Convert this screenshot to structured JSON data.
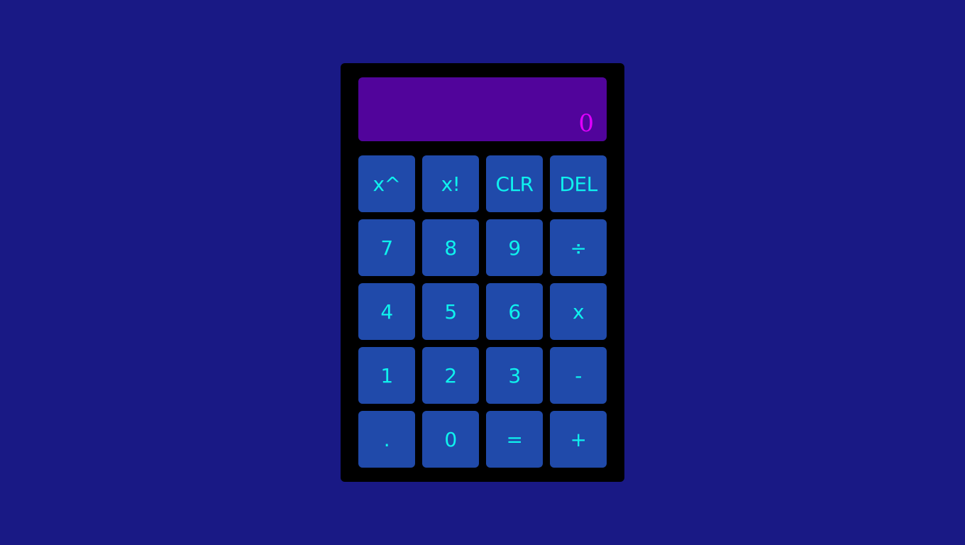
{
  "display": {
    "value": "0"
  },
  "keys": [
    {
      "id": "power",
      "label": "x^"
    },
    {
      "id": "factorial",
      "label": "x!"
    },
    {
      "id": "clear",
      "label": "CLR"
    },
    {
      "id": "delete",
      "label": "DEL"
    },
    {
      "id": "7",
      "label": "7"
    },
    {
      "id": "8",
      "label": "8"
    },
    {
      "id": "9",
      "label": "9"
    },
    {
      "id": "divide",
      "label": "÷"
    },
    {
      "id": "4",
      "label": "4"
    },
    {
      "id": "5",
      "label": "5"
    },
    {
      "id": "6",
      "label": "6"
    },
    {
      "id": "multiply",
      "label": "x"
    },
    {
      "id": "1",
      "label": "1"
    },
    {
      "id": "2",
      "label": "2"
    },
    {
      "id": "3",
      "label": "3"
    },
    {
      "id": "subtract",
      "label": "-"
    },
    {
      "id": "decimal",
      "label": "."
    },
    {
      "id": "0",
      "label": "0"
    },
    {
      "id": "equals",
      "label": "="
    },
    {
      "id": "add",
      "label": "+"
    }
  ],
  "colors": {
    "page_background": "#191985",
    "calculator_body": "#000000",
    "display_background": "#51049b",
    "display_text": "#e000ff",
    "key_background": "#204aaa",
    "key_text": "#0ff2ee"
  }
}
